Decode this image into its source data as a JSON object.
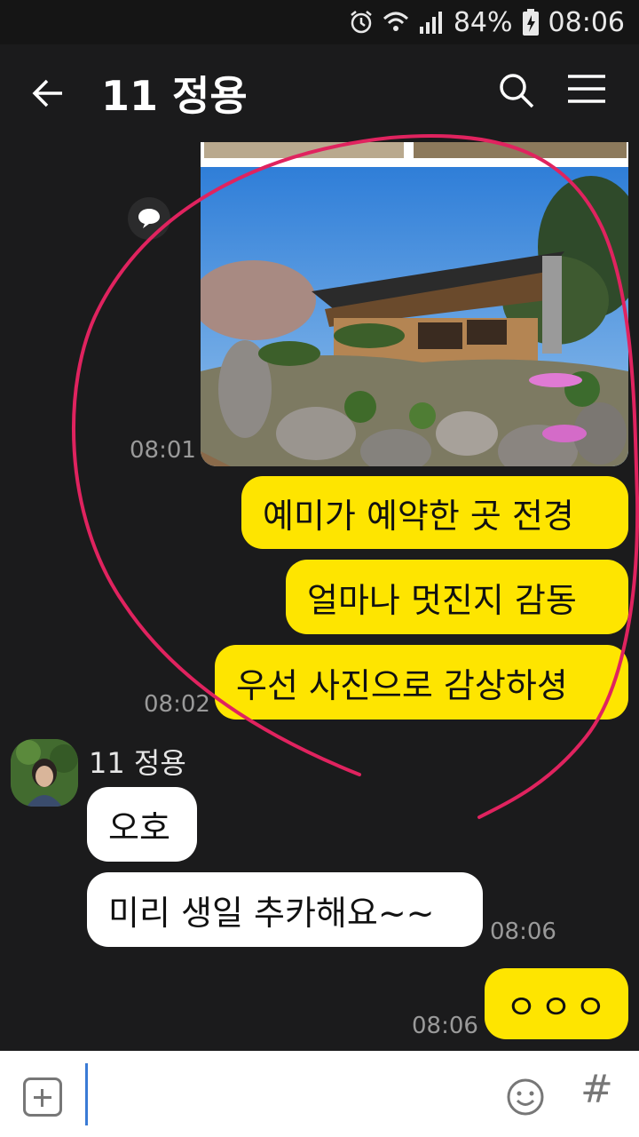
{
  "status": {
    "battery": "84%",
    "time": "08:06"
  },
  "header": {
    "title": "11 정용"
  },
  "messages": {
    "photo_time": "08:01",
    "bubble1": "예미가 예약한 곳 전경",
    "bubble2": "얼마나 멋진지 감동",
    "bubble3": "우선 사진으로 감상하셩",
    "group1_time": "08:02",
    "sender": "11 정용",
    "reply1": "오호",
    "reply2": "미리 생일 추카해요~~",
    "reply_time": "08:06",
    "bubble4": "ㅇㅇㅇ",
    "bubble4_time": "08:06"
  },
  "input": {
    "value": ""
  },
  "colors": {
    "my_bubble": "#fee500",
    "annotation": "#e0235f",
    "background": "#1b1b1c"
  }
}
